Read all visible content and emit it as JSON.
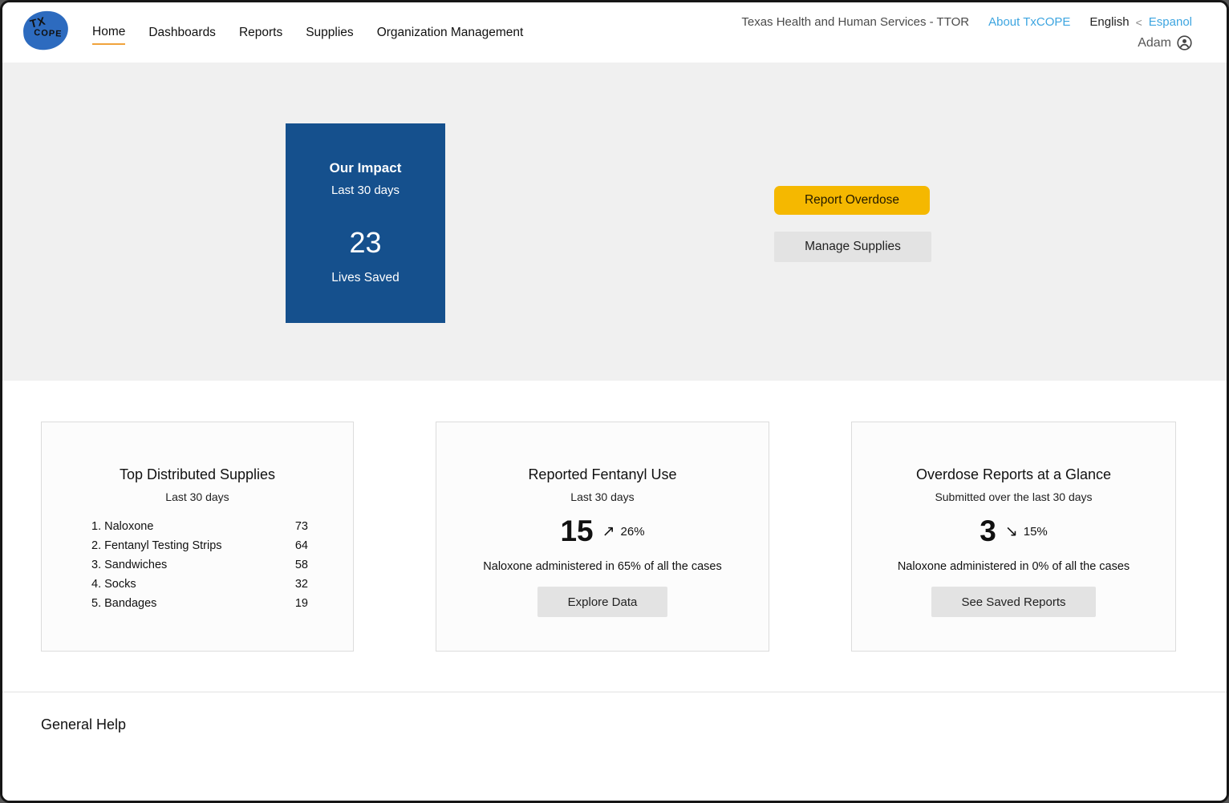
{
  "header": {
    "brand": {
      "line1": "TX",
      "line2": "COPE"
    },
    "nav": [
      {
        "label": "Home",
        "active": true
      },
      {
        "label": "Dashboards",
        "active": false
      },
      {
        "label": "Reports",
        "active": false
      },
      {
        "label": "Supplies",
        "active": false
      },
      {
        "label": "Organization Management",
        "active": false
      }
    ],
    "org_label": "Texas Health and Human Services - TTOR",
    "about_link": "About TxCOPE",
    "language": {
      "current": "English",
      "separator": "<",
      "other": "Espanol"
    },
    "user_name": "Adam"
  },
  "hero": {
    "impact": {
      "title": "Our Impact",
      "subtitle": "Last 30 days",
      "value": "23",
      "label": "Lives Saved"
    },
    "report_button": "Report Overdose",
    "supplies_button": "Manage Supplies"
  },
  "cards": {
    "supplies": {
      "title": "Top Distributed Supplies",
      "subtitle": "Last 30 days",
      "items": [
        {
          "rank": "1. Naloxone",
          "value": "73"
        },
        {
          "rank": "2. Fentanyl Testing Strips",
          "value": "64"
        },
        {
          "rank": "3. Sandwiches",
          "value": "58"
        },
        {
          "rank": "4. Socks",
          "value": "32"
        },
        {
          "rank": "5. Bandages",
          "value": "19"
        }
      ]
    },
    "fentanyl": {
      "title": "Reported Fentanyl Use",
      "subtitle": "Last 30 days",
      "value": "15",
      "trend_icon": "↗",
      "trend_percent": "26%",
      "note": "Naloxone administered in 65% of all the cases",
      "button": "Explore Data"
    },
    "overdose": {
      "title": "Overdose Reports at a Glance",
      "subtitle": "Submitted over the last 30 days",
      "value": "3",
      "trend_icon": "↘",
      "trend_percent": "15%",
      "note": "Naloxone administered in 0% of all the cases",
      "button": "See Saved Reports"
    }
  },
  "footer": {
    "help_label": "General Help"
  },
  "colors": {
    "impact_blue": "#15508d",
    "accent_yellow": "#f5b800",
    "link_blue": "#3da5e0",
    "nav_underline": "#f0a33c"
  }
}
